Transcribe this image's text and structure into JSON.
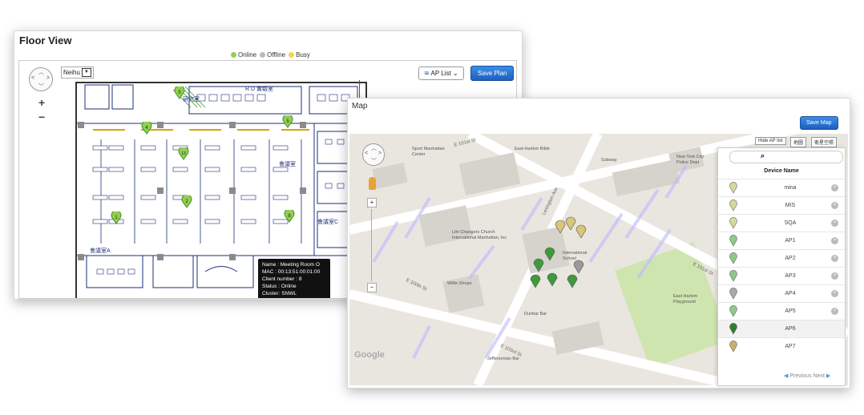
{
  "floor_view": {
    "title": "Floor View",
    "legend": [
      {
        "label": "Online",
        "color": "#8fd14f"
      },
      {
        "label": "Offline",
        "color": "#bbbbbb"
      },
      {
        "label": "Busy",
        "color": "#f2d649"
      }
    ],
    "site_select": "Neihu",
    "ap_list_label": "AP List",
    "save_plan_label": "Save Plan",
    "zoom_in": "+",
    "zoom_out": "−",
    "plan_labels": {
      "rd": "R D 實驗室",
      "meeting_a": "會議室A",
      "meeting_b": "會議室",
      "meeting_c": "會議室C",
      "meeting_top": "會議室",
      "room_label": "研究室"
    },
    "ap_pins": [
      "5",
      "4",
      "13",
      "2",
      "1",
      "5",
      "8"
    ],
    "pin_color": "#8fd14f",
    "tooltip": {
      "name": "Name : Meeting Room O",
      "mac": "MAC : 00:13:51:00:01:00",
      "clients": "Client number : 8",
      "status": "Status : Online",
      "cluster": "Cluster: SNWL"
    }
  },
  "map_view": {
    "title": "Map",
    "save_map_label": "Save Map",
    "hide_ap_list": "Hide AP list",
    "map_type_1": "地圖",
    "map_type_2": "衛星空照",
    "streets": [
      "E 101st St",
      "E 100th St",
      "Lexington Ave",
      "E 103rd St",
      "E 101st St",
      "Lexington Ave",
      "E 101st St"
    ],
    "places": [
      "Sport Manhattan Center",
      "East Harlem Bible",
      "Subway",
      "New York City Police Dept",
      "Life Changers Church International Manhattan, Inc",
      "International School",
      "Willie Shope",
      "East Harlem Playground",
      "Dunbar Bar",
      "Jeffersonian Bar"
    ],
    "attribution": "Google",
    "ap_list_header": "Device Name",
    "ap_list": [
      {
        "name": "mina",
        "color": "#d7d89a"
      },
      {
        "name": "MIS",
        "color": "#d7d89a"
      },
      {
        "name": "SQA",
        "color": "#d7d89a"
      },
      {
        "name": "AP1",
        "color": "#8fc98a"
      },
      {
        "name": "AP2",
        "color": "#8fc98a"
      },
      {
        "name": "AP3",
        "color": "#8fc98a"
      },
      {
        "name": "AP4",
        "color": "#a9a9a9"
      },
      {
        "name": "AP5",
        "color": "#8fc98a"
      },
      {
        "name": "AP6",
        "color": "#2f7d32"
      },
      {
        "name": "AP7",
        "color": "#c5b36a"
      }
    ],
    "delete_symbol": "×",
    "previous": "Previous",
    "next": "Next",
    "marker_colors": {
      "yellow": "#d8c77a",
      "green": "#3f9a3c",
      "gray": "#9a9a9a"
    }
  }
}
